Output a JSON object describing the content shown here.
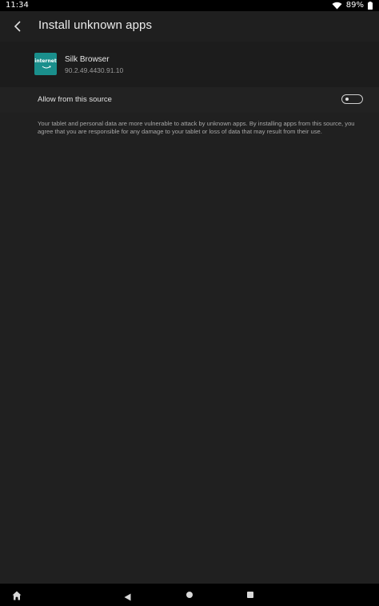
{
  "status_bar": {
    "time": "11:34",
    "battery_percent": "89%",
    "icons": [
      "wifi-icon",
      "battery-icon"
    ]
  },
  "header": {
    "title": "Install unknown apps",
    "back_icon": "back-arrow-icon"
  },
  "app": {
    "icon_label": "internet",
    "name": "Silk Browser",
    "version": "90.2.49.4430.91.10",
    "icon_color": "#1a8f8c"
  },
  "setting": {
    "label": "Allow from this source",
    "toggle_on": false
  },
  "warning": {
    "text": "Your tablet and personal data are more vulnerable to attack by unknown apps. By installing apps from this source, you agree that you are responsible for any damage to your tablet or loss of data that may result from their use."
  },
  "nav_bar": {
    "icons": [
      "fire-home-icon",
      "back-triangle-icon",
      "home-circle-icon",
      "recents-square-icon"
    ]
  },
  "colors": {
    "background": "#202020",
    "status_bar": "#000000",
    "nav_bar": "#000000",
    "text_primary": "#e8e8e8",
    "text_secondary": "#a8a8a8"
  }
}
